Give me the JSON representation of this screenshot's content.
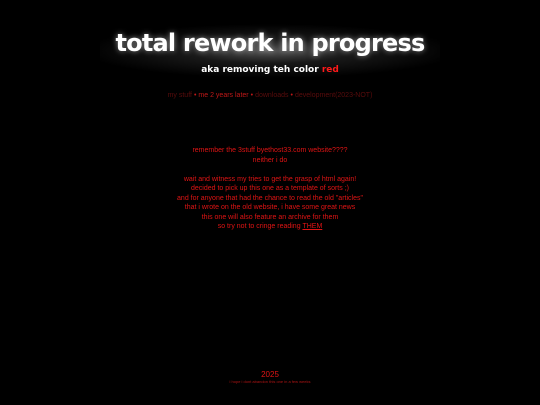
{
  "header": {
    "title": "total rework in progress",
    "subtitle_prefix": "aka removing teh color",
    "subtitle_red": "red"
  },
  "nav": {
    "items": [
      {
        "label": "my stuff",
        "state": "dim"
      },
      {
        "label": "me 2 years later",
        "state": "current"
      },
      {
        "label": "downloads",
        "state": "dim"
      },
      {
        "label": "development(2023-NOT)",
        "state": "dim"
      }
    ],
    "separator": "•"
  },
  "content": {
    "lines": [
      "remember the 3stuff byethost33.com website????",
      "neither i do",
      "",
      "wait and witness my tries to get the grasp of html again!",
      "decided to pick up this one as a template of sorts ;)",
      "and for anyone that had the chance to read the old \"articles\"",
      "that i wrote on the old website, i have some great news",
      "this one will also feature an archive for them"
    ],
    "last_line_prefix": "so try not to cringe reading",
    "last_line_link": "THEM"
  },
  "footer": {
    "year": "2025",
    "note": "i hope i dont abandon this one in a few weeks"
  },
  "colors": {
    "background": "#000000",
    "accent_red": "#e01414",
    "dim_red": "#5a0c0c"
  }
}
